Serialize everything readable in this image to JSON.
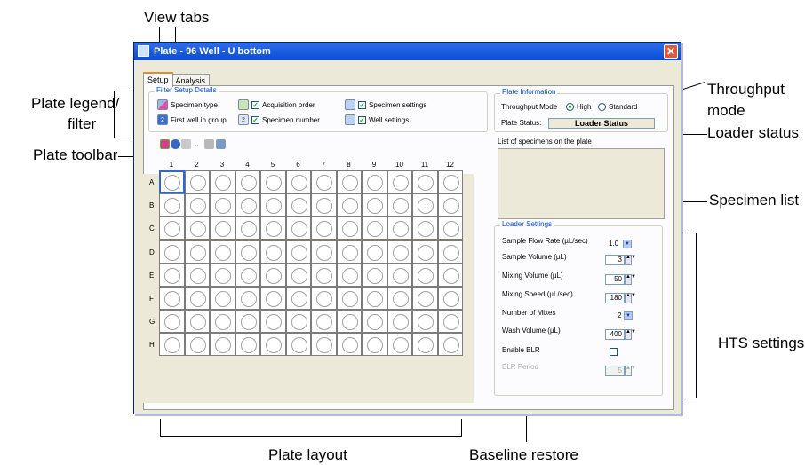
{
  "callouts": {
    "view_tabs": "View tabs",
    "plate_legend": "Plate legend/",
    "plate_legend_2": "filter",
    "plate_toolbar": "Plate toolbar",
    "throughput": "Throughput",
    "throughput_2": "mode",
    "loader_status": "Loader status",
    "specimen_list": "Specimen list",
    "hts_settings": "HTS settings",
    "plate_layout": "Plate layout",
    "baseline_restore": "Baseline restore"
  },
  "window": {
    "title": "Plate - 96 Well - U bottom",
    "close_symbol": "✕"
  },
  "tabs": [
    {
      "label": "Setup"
    },
    {
      "label": "Analysis"
    }
  ],
  "filter": {
    "title": "Filter Setup Details",
    "items": [
      {
        "label": "Specimen type"
      },
      {
        "label": "First well in group",
        "icon_text": "2"
      },
      {
        "label": "Acquisition order",
        "checked": true
      },
      {
        "label": "Specimen number",
        "checked": true,
        "icon_text": "2"
      },
      {
        "label": "Specimen settings",
        "checked": true
      },
      {
        "label": "Well settings",
        "checked": true
      }
    ]
  },
  "plate": {
    "columns": [
      "1",
      "2",
      "3",
      "4",
      "5",
      "6",
      "7",
      "8",
      "9",
      "10",
      "11",
      "12"
    ],
    "rows": [
      "A",
      "B",
      "C",
      "D",
      "E",
      "F",
      "G",
      "H"
    ]
  },
  "plate_info": {
    "title": "Plate Information",
    "throughput_label": "Throughput Mode",
    "high_label": "High",
    "standard_label": "Standard",
    "selected": "High",
    "status_label": "Plate Status:",
    "status_value": "Loader Status"
  },
  "specimen_list": {
    "label": "List of specimens on the plate"
  },
  "loader": {
    "title": "Loader Settings",
    "flow_rate_label": "Sample Flow Rate (µL/sec)",
    "flow_rate_value": "1.0",
    "sample_volume_label": "Sample Volume (µL)",
    "sample_volume_value": "3",
    "mixing_volume_label": "Mixing Volume (µL)",
    "mixing_volume_value": "50",
    "mixing_speed_label": "Mixing Speed (µL/sec)",
    "mixing_speed_value": "180",
    "num_mixes_label": "Number of Mixes",
    "num_mixes_value": "2",
    "wash_volume_label": "Wash Volume (µL)",
    "wash_volume_value": "400",
    "enable_blr_label": "Enable BLR",
    "enable_blr_checked": false,
    "blr_period_label": "BLR Period",
    "blr_period_value": "5"
  }
}
